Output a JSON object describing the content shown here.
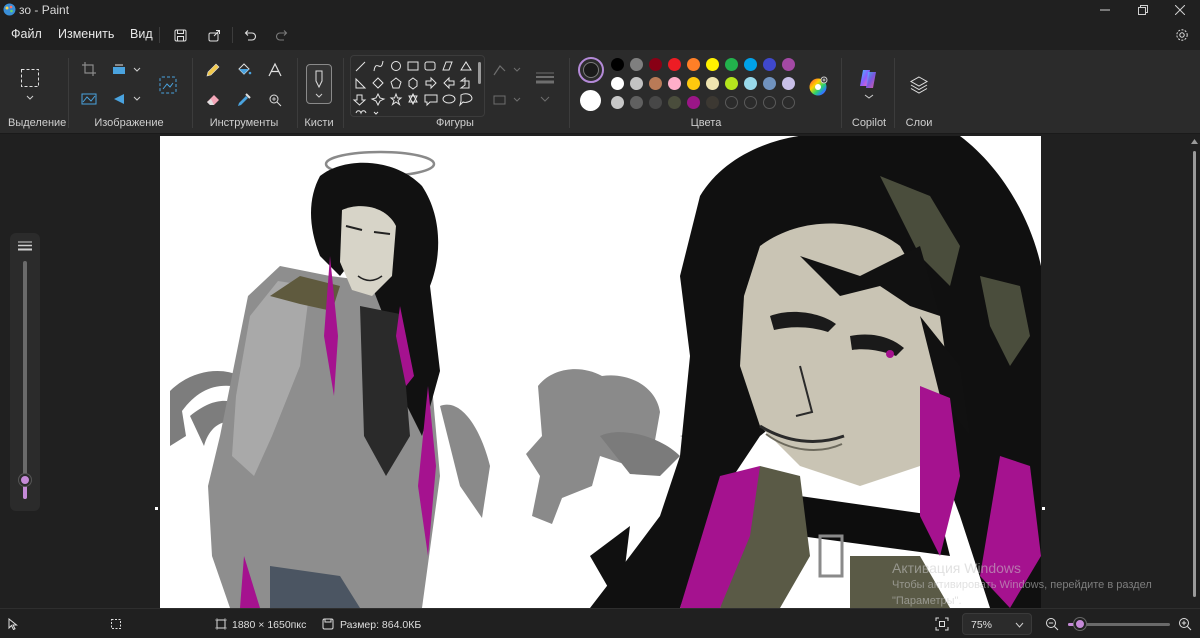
{
  "window": {
    "title": "зо - Paint",
    "minimize_icon": "minimize-icon",
    "maximize_icon": "restore-icon",
    "close_icon": "close-icon"
  },
  "menu": {
    "file": "Файл",
    "edit": "Изменить",
    "view": "Вид"
  },
  "ribbon": {
    "groups": {
      "selection": "Выделение",
      "image": "Изображение",
      "tools": "Инструменты",
      "brushes": "Кисти",
      "shapes": "Фигуры",
      "colors": "Цвета",
      "copilot": "Copilot",
      "layers": "Слои"
    },
    "primary_color": "#1a1a1a",
    "secondary_color": "#ffffff",
    "palette_row1": [
      "#000000",
      "#7f7f7f",
      "#880015",
      "#ed1c24",
      "#ff7f27",
      "#fff200",
      "#22b14c",
      "#00a2e8",
      "#3f48cc",
      "#a349a4"
    ],
    "palette_row2": [
      "#ffffff",
      "#c3c3c3",
      "#b97a57",
      "#ffaec9",
      "#ffc90e",
      "#efe4b0",
      "#b5e61d",
      "#99d9ea",
      "#7092be",
      "#c8bfe7"
    ],
    "palette_row3": [
      "#c8c8c8",
      "#606060",
      "#474747",
      "#4a4d3c",
      "#9b1687",
      "#3c3832",
      "",
      "",
      "",
      ""
    ]
  },
  "status": {
    "dimensions": "1880 × 1650пкс",
    "size": "Размер: 864.0КБ",
    "zoom": "75%",
    "zoom_level": 0.12
  },
  "watermark": {
    "line1": "Активация Windows",
    "line2": "Чтобы активировать Windows, перейдите в раздел",
    "line3": "\"Параметры\"."
  }
}
